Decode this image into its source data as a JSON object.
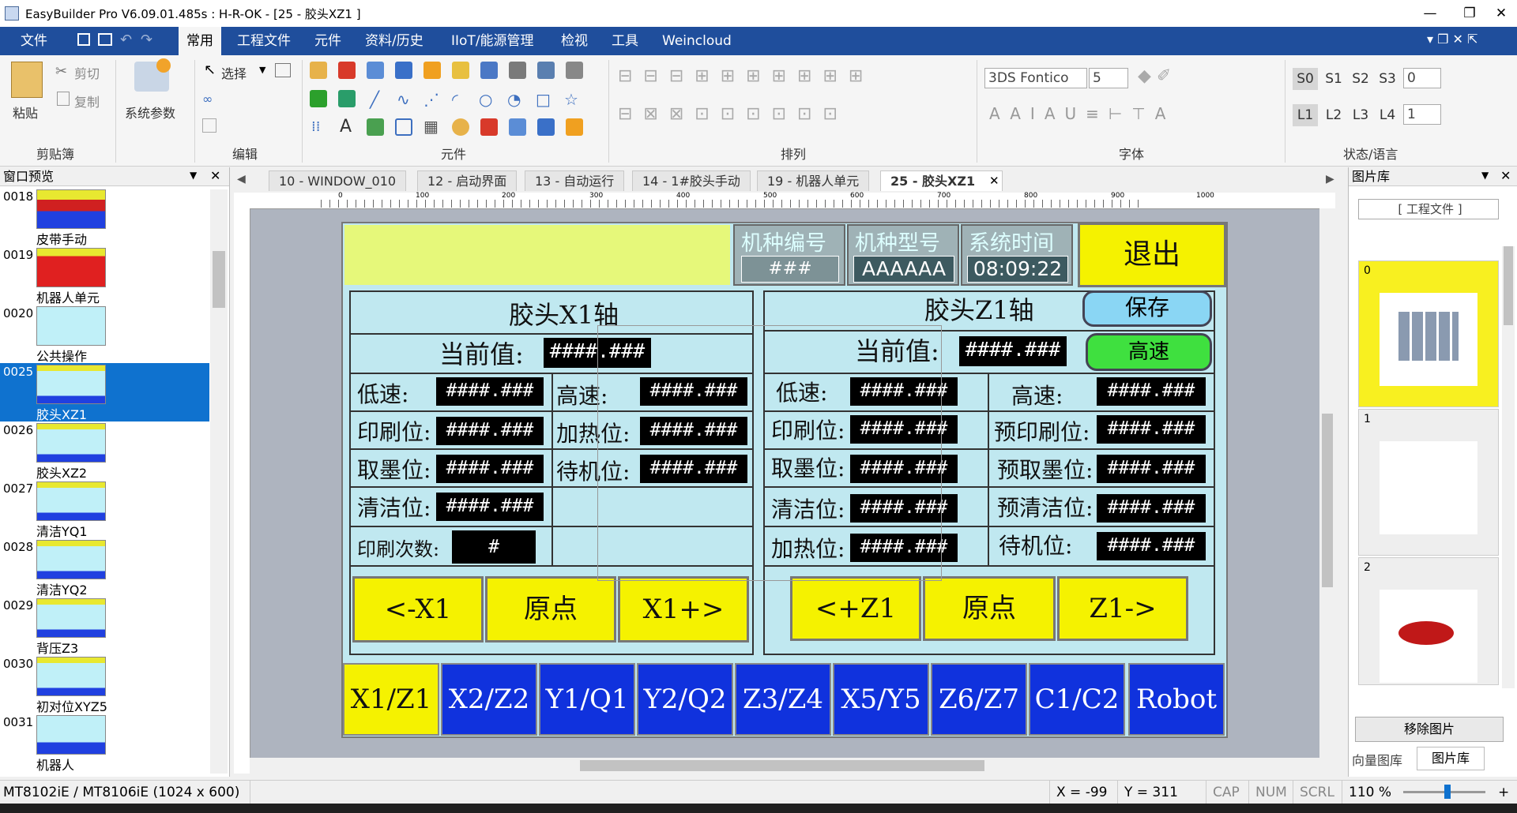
{
  "window": {
    "title": "EasyBuilder Pro V6.09.01.485s : H-R-OK - [25 - 胶头XZ1 ]",
    "minimize": "—",
    "restore": "❐",
    "close": "✕"
  },
  "ribbon_tabs": [
    "文件",
    "常用",
    "工程文件",
    "元件",
    "资料/历史",
    "IIoT/能源管理",
    "检视",
    "工具",
    "Weincloud"
  ],
  "ribbon": {
    "clipboard": {
      "paste": "粘贴",
      "cut": "剪切",
      "copy": "复制",
      "label": "剪贴簿"
    },
    "system": {
      "params": "系统参数"
    },
    "edit": {
      "select": "选择",
      "label": "编辑"
    },
    "components_label": "元件",
    "arrange_label": "排列",
    "font": {
      "name": "3DS Fontico",
      "size": "5",
      "label": "字体"
    },
    "state": {
      "s_buttons": [
        "S0",
        "S1",
        "S2",
        "S3"
      ],
      "l_buttons": [
        "L1",
        "L2",
        "L3",
        "L4"
      ],
      "state_value": "0",
      "lang_value": "1",
      "label": "状态/语言"
    }
  },
  "left_panel": {
    "title": "窗口预览",
    "items": [
      {
        "num": "0018",
        "name": "皮带手动"
      },
      {
        "num": "0019",
        "name": "机器人单元"
      },
      {
        "num": "0020",
        "name": "公共操作"
      },
      {
        "num": "0025",
        "name": "胶头XZ1",
        "selected": true
      },
      {
        "num": "0026",
        "name": "胶头XZ2"
      },
      {
        "num": "0027",
        "name": "清洁YQ1"
      },
      {
        "num": "0028",
        "name": "清洁YQ2"
      },
      {
        "num": "0029",
        "name": "背压Z3"
      },
      {
        "num": "0030",
        "name": "初对位XYZ5"
      },
      {
        "num": "0031",
        "name": "机器人"
      }
    ]
  },
  "doc_tabs": [
    "10 - WINDOW_010",
    "12 - 启动界面",
    "13 - 自动运行",
    "14 - 1#胶头手动",
    "19 - 机器人单元",
    "25 - 胶头XZ1"
  ],
  "ruler_marks": [
    "0",
    "100",
    "200",
    "300",
    "400",
    "500",
    "600",
    "700",
    "800",
    "900",
    "1000"
  ],
  "hmi": {
    "header": {
      "model_no_label": "机种编号",
      "model_no_value": "###",
      "model_type_label": "机种型号",
      "model_type_value": "AAAAAA",
      "time_label": "系统时间",
      "time_value": "08:09:22",
      "exit": "退出"
    },
    "x1": {
      "title": "胶头X1轴",
      "current_label": "当前值:",
      "current_value": "####.###",
      "rows": [
        {
          "l1": "低速:",
          "v1": "####.###",
          "l2": "高速:",
          "v2": "####.###"
        },
        {
          "l1": "印刷位:",
          "v1": "####.###",
          "l2": "加热位:",
          "v2": "####.###"
        },
        {
          "l1": "取墨位:",
          "v1": "####.###",
          "l2": "待机位:",
          "v2": "####.###"
        },
        {
          "l1": "清洁位:",
          "v1": "####.###"
        }
      ],
      "print_count_label": "印刷次数:",
      "print_count_value": "#",
      "buttons": [
        "<-X1",
        "原点",
        "X1+>"
      ]
    },
    "z1": {
      "title": "胶头Z1轴",
      "save": "保存",
      "high_speed": "高速",
      "current_label": "当前值:",
      "current_value": "####.###",
      "rows": [
        {
          "l1": "低速:",
          "v1": "####.###",
          "l2": "高速:",
          "v2": "####.###"
        },
        {
          "l1": "印刷位:",
          "v1": "####.###",
          "l2": "预印刷位:",
          "v2": "####.###"
        },
        {
          "l1": "取墨位:",
          "v1": "####.###",
          "l2": "预取墨位:",
          "v2": "####.###"
        },
        {
          "l1": "清洁位:",
          "v1": "####.###",
          "l2": "预清洁位:",
          "v2": "####.###"
        },
        {
          "l1": "加热位:",
          "v1": "####.###",
          "l2": "待机位:",
          "v2": "####.###"
        }
      ],
      "buttons": [
        "<+Z1",
        "原点",
        "Z1->"
      ]
    },
    "bottom_tabs": [
      "X1/Z1",
      "X2/Z2",
      "Y1/Q1",
      "Y2/Q2",
      "Z3/Z4",
      "X5/Y5",
      "Z6/Z7",
      "C1/C2",
      "Robot"
    ]
  },
  "right_panel": {
    "title": "图片库",
    "combo": "[ 工程文件 ]",
    "items": [
      "0",
      "1",
      "2"
    ],
    "remove_button": "移除图片",
    "bottom_tabs": [
      "向量图库",
      "图片库"
    ]
  },
  "status": {
    "model": "MT8102iE / MT8106iE (1024 x 600)",
    "x": "X = -99",
    "y": "Y = 311",
    "cap": "CAP",
    "num": "NUM",
    "scrl": "SCRL",
    "zoom": "110 %"
  },
  "colors": {
    "ribbon_blue": "#1f4e9c",
    "hmi_bg": "#c0e8f0",
    "yellow_button": "#f5f200",
    "blue_button": "#1032dd",
    "green_button": "#3fe03f",
    "selected": "#0f72cf"
  }
}
